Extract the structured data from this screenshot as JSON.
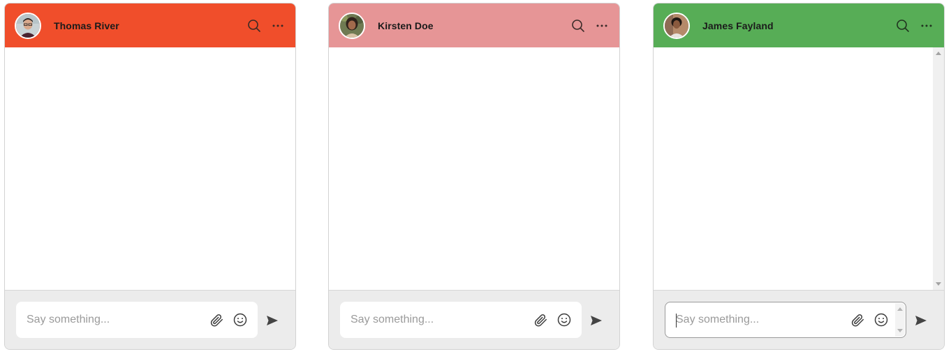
{
  "chats": [
    {
      "name": "Thomas River",
      "header_color": "#f04e2b",
      "input_placeholder": "Say something...",
      "input_value": ""
    },
    {
      "name": "Kirsten Doe",
      "header_color": "#e69596",
      "input_placeholder": "Say something...",
      "input_value": ""
    },
    {
      "name": "James Fayland",
      "header_color": "#57ad56",
      "input_placeholder": "Say something...",
      "input_value": ""
    }
  ],
  "icons": {
    "search": "search-icon",
    "more": "more-horizontal-icon",
    "attach": "paperclip-icon",
    "emoji": "smiley-icon",
    "send": "send-icon"
  },
  "colors": {
    "icon_gray": "#4a4a4a",
    "footer_bg": "#ececec"
  }
}
